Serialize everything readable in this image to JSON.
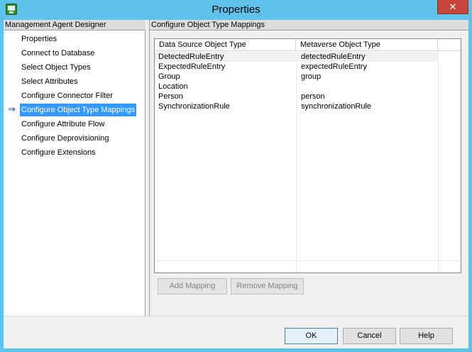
{
  "window": {
    "title": "Properties",
    "close_label": "✕"
  },
  "left_pane": {
    "header": "Management Agent Designer",
    "selected_indicator": "⇒",
    "items": [
      {
        "label": "Properties"
      },
      {
        "label": "Connect to Database"
      },
      {
        "label": "Select Object Types"
      },
      {
        "label": "Select Attributes"
      },
      {
        "label": "Configure Connector Filter"
      },
      {
        "label": "Configure Object Type Mappings"
      },
      {
        "label": "Configure Attribute Flow"
      },
      {
        "label": "Configure Deprovisioning"
      },
      {
        "label": "Configure Extensions"
      }
    ],
    "selected_index": 5
  },
  "right_pane": {
    "header": "Configure Object Type Mappings",
    "list": {
      "columns": [
        "Data Source Object Type",
        "Metaverse Object Type"
      ],
      "rows": [
        {
          "source": "DetectedRuleEntry",
          "metaverse": "detectedRuleEntry"
        },
        {
          "source": "ExpectedRuleEntry",
          "metaverse": "expectedRuleEntry"
        },
        {
          "source": "Group",
          "metaverse": "group"
        },
        {
          "source": "Location",
          "metaverse": ""
        },
        {
          "source": "Person",
          "metaverse": "person"
        },
        {
          "source": "SynchronizationRule",
          "metaverse": "synchronizationRule"
        }
      ],
      "selected_row": 0
    },
    "add_mapping_label": "Add Mapping",
    "remove_mapping_label": "Remove Mapping"
  },
  "footer": {
    "ok_label": "OK",
    "cancel_label": "Cancel",
    "help_label": "Help"
  },
  "colors": {
    "window_frame": "#5ec2ea",
    "selection": "#3399ff",
    "close_button": "#c7463c"
  }
}
